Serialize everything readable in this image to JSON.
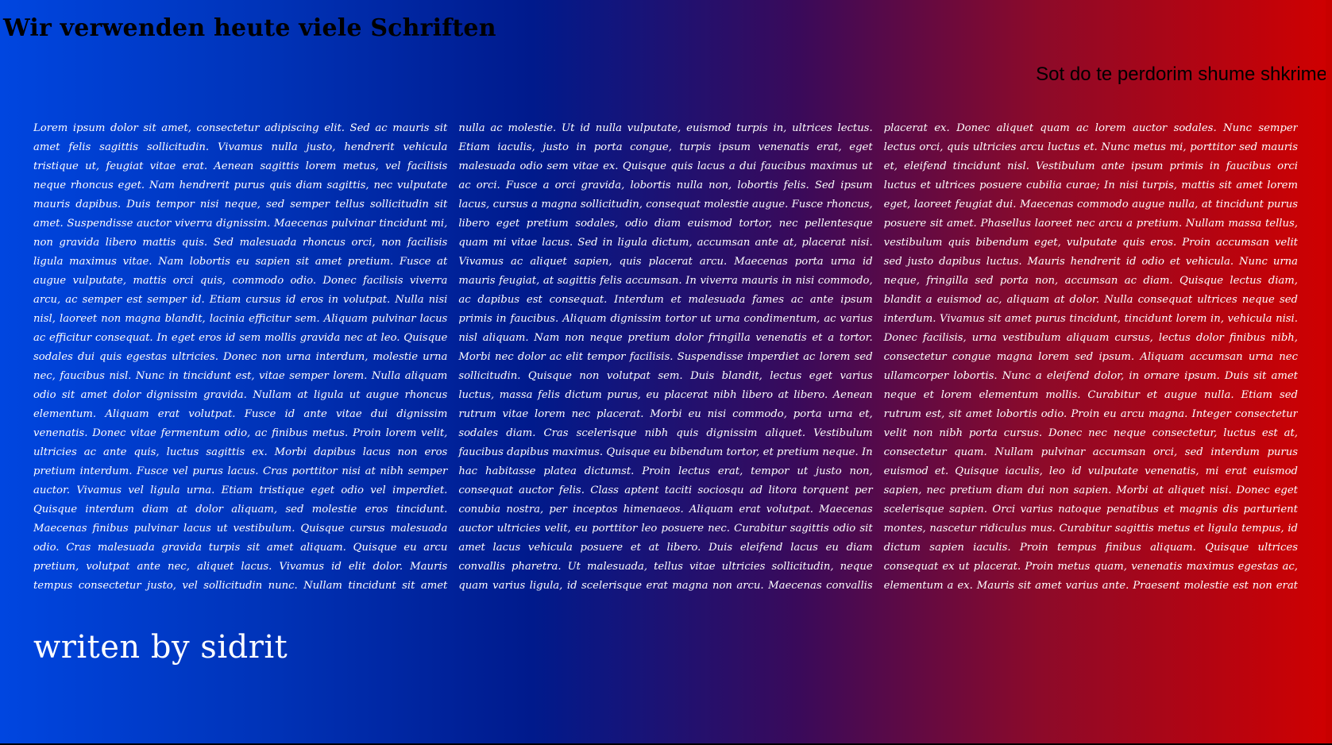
{
  "page": {
    "heading": "Wir verwenden heute viele Schriften",
    "subheading": "Sot do te perdorim shume shkrime",
    "body_text": "Lorem ipsum dolor sit amet, consectetur adipiscing elit. Sed ac mauris sit amet felis sagittis sollicitudin. Vivamus nulla justo, hendrerit vehicula tristique ut, feugiat vitae erat. Aenean sagittis lorem metus, vel facilisis neque rhoncus eget. Nam hendrerit purus quis diam sagittis, nec vulputate mauris dapibus. Duis tempor nisi neque, sed semper tellus sollicitudin sit amet. Suspendisse auctor viverra dignissim. Maecenas pulvinar tincidunt mi, non gravida libero mattis quis. Sed malesuada rhoncus orci, non facilisis ligula maximus vitae. Nam lobortis eu sapien sit amet pretium. Fusce at augue vulputate, mattis orci quis, commodo odio. Donec facilisis viverra arcu, ac semper est semper id. Etiam cursus id eros in volutpat. Nulla nisi nisl, laoreet non magna blandit, lacinia efficitur sem. Aliquam pulvinar lacus ac efficitur consequat. In eget eros id sem mollis gravida nec at leo. Quisque sodales dui quis egestas ultricies. Donec non urna interdum, molestie urna nec, faucibus nisl. Nunc in tincidunt est, vitae semper lorem. Nulla aliquam odio sit amet dolor dignissim gravida. Nullam at ligula ut augue rhoncus elementum. Aliquam erat volutpat. Fusce id ante vitae dui dignissim venenatis. Donec vitae fermentum odio, ac finibus metus. Proin lorem velit, ultricies ac ante quis, luctus sagittis ex. Morbi dapibus lacus non eros pretium interdum. Fusce vel purus lacus. Cras porttitor nisi at nibh semper auctor. Vivamus vel ligula urna. Etiam tristique eget odio vel imperdiet. Quisque interdum diam at dolor aliquam, sed molestie eros tincidunt. Maecenas finibus pulvinar lacus ut vestibulum. Quisque cursus malesuada odio. Cras malesuada gravida turpis sit amet aliquam. Quisque eu arcu pretium, volutpat ante nec, aliquet lacus. Vivamus id elit dolor. Mauris tempus consectetur justo, vel sollicitudin nunc. Nullam tincidunt sit amet nulla ac molestie. Ut id nulla vulputate, euismod turpis in, ultrices lectus. Etiam iaculis, justo in porta congue, turpis ipsum venenatis erat, eget malesuada odio sem vitae ex. Quisque quis lacus a dui faucibus maximus ut ac orci. Fusce a orci gravida, lobortis nulla non, lobortis felis. Sed ipsum lacus, cursus a magna sollicitudin, consequat molestie augue. Fusce rhoncus, libero eget pretium sodales, odio diam euismod tortor, nec pellentesque quam mi vitae lacus. Sed in ligula dictum, accumsan ante at, placerat nisi. Vivamus ac aliquet sapien, quis placerat arcu. Maecenas porta urna id mauris feugiat, at sagittis felis accumsan. In viverra mauris in nisi commodo, ac dapibus est consequat. Interdum et malesuada fames ac ante ipsum primis in faucibus. Aliquam dignissim tortor ut urna condimentum, ac varius nisl aliquam. Nam non neque pretium dolor fringilla venenatis et a tortor. Morbi nec dolor ac elit tempor facilisis. Suspendisse imperdiet ac lorem sed sollicitudin. Quisque non volutpat sem. Duis blandit, lectus eget varius luctus, massa felis dictum purus, eu placerat nibh libero at libero. Aenean rutrum vitae lorem nec placerat. Morbi eu nisi commodo, porta urna et, sodales diam. Cras scelerisque nibh quis dignissim aliquet. Vestibulum faucibus dapibus maximus. Quisque eu bibendum tortor, et pretium neque. In hac habitasse platea dictumst. Proin lectus erat, tempor ut justo non, consequat auctor felis. Class aptent taciti sociosqu ad litora torquent per conubia nostra, per inceptos himenaeos. Aliquam erat volutpat. Maecenas auctor ultricies velit, eu porttitor leo posuere nec. Curabitur sagittis odio sit amet lacus vehicula posuere et at libero. Duis eleifend lacus eu diam convallis pharetra. Ut malesuada, tellus vitae ultricies sollicitudin, neque quam varius ligula, id scelerisque erat magna non arcu. Maecenas convallis placerat ex. Donec aliquet quam ac lorem auctor sodales. Nunc semper lectus orci, quis ultricies arcu luctus et. Nunc metus mi, porttitor sed mauris et, eleifend tincidunt nisl. Vestibulum ante ipsum primis in faucibus orci luctus et ultrices posuere cubilia curae; In nisi turpis, mattis sit amet lorem eget, laoreet feugiat dui. Maecenas commodo augue nulla, at tincidunt purus posuere sit amet. Phasellus laoreet nec arcu a pretium. Nullam massa tellus, vestibulum quis bibendum eget, vulputate quis eros. Proin accumsan velit sed justo dapibus luctus. Mauris hendrerit id odio et vehicula. Nunc urna neque, fringilla sed porta non, accumsan ac diam. Quisque lectus diam, blandit a euismod ac, aliquam at dolor. Nulla consequat ultrices neque sed interdum. Vivamus sit amet purus tincidunt, tincidunt lorem in, vehicula nisi. Donec facilisis, urna vestibulum aliquam cursus, lectus dolor finibus nibh, consectetur congue magna lorem sed ipsum. Aliquam accumsan urna nec ullamcorper lobortis. Nunc a eleifend dolor, in ornare ipsum. Duis sit amet neque et lorem elementum mollis. Curabitur et augue nulla. Etiam sed rutrum est, sit amet lobortis odio. Proin eu arcu magna. Integer consectetur velit non nibh porta cursus. Donec nec neque consectetur, luctus est at, consectetur quam. Nullam pulvinar accumsan orci, sed interdum purus euismod et. Quisque iaculis, leo id vulputate venenatis, mi erat euismod sapien, nec pretium diam dui non sapien. Morbi at aliquet nisi. Donec eget scelerisque sapien. Orci varius natoque penatibus et magnis dis parturient montes, nascetur ridiculus mus. Curabitur sagittis metus et ligula tempus, id dictum sapien iaculis. Proin tempus finibus aliquam. Quisque ultrices consequat ex ut placerat. Proin metus quam, venenatis maximus egestas ac, elementum a ex. Mauris sit amet varius ante. Praesent molestie est non erat imperdiet cursus. Donec ut vestibulum turpis, ac facilisis arcu. Sed auctor et dolor nec viverra. Pellentesque pharetra tincidunt nibh, vitae ultrices tellus tempor sed. Vestibulum vitae justo tortor. Morbi ornare leo dolor, quis placerat sem interdum vel. Ut mauris dui, feugiat nec fringilla varius, sollicitudin ut dolor. Etiam nec augue ac lorem fermentum malesuada. Praesent porta aliquam mauris nec egestas. Mauris porta urna sit amet pharetra tristique. Duis volutpat malesuada lorem et faucibus. Praesent tempor ipsum sed tortor rutrum, sed tincidunt enim mollis. Curabitur nunc odio, volutpat eget lobortis placerat, egestas dapibus quam. Aliquam mollis massa sit amet ex lobortis, id consequat odio dignissim. Ut at faucibus nunc. Cras ullamcorper porttitor nisl ac pharetra. Fusce sed odio nisl. Sed commodo accumsan sapien vel tincidunt. Etiam finibus interdum sagittis. Nunc venenatis sagittis auctor.",
    "author": "writen by sidrit"
  },
  "colors": {
    "gradient_left": "#0046e0",
    "gradient_mid": "#001a8c",
    "gradient_right": "#d00000",
    "body_text": "#ffffff",
    "heading_text": "#000000"
  }
}
